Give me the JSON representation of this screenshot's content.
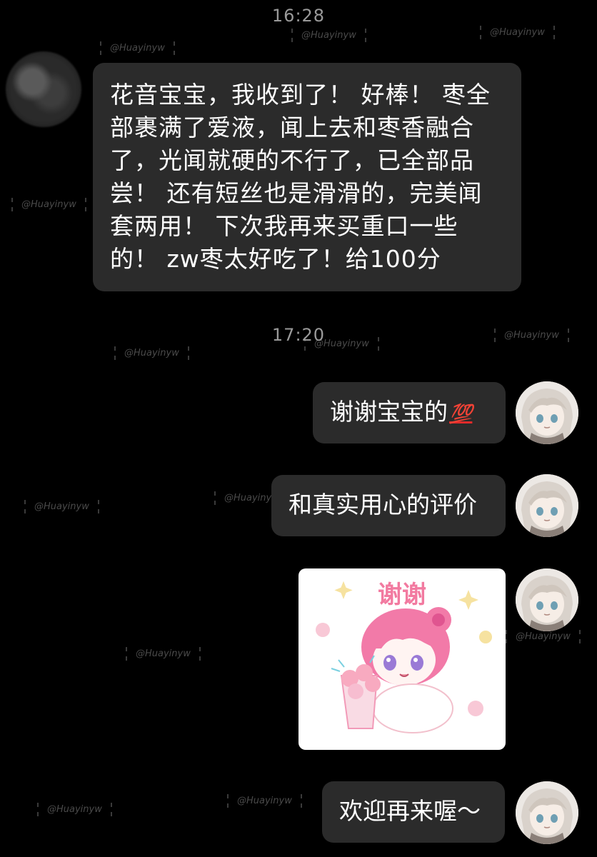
{
  "chat": {
    "time_1": "16:28",
    "time_2": "17:20",
    "incoming_message": "花音宝宝，我收到了！ 好棒！ 枣全部裹满了爱液，闻上去和枣香融合了，光闻就硬的不行了，已全部品尝！ 还有短丝也是滑滑的，完美闻套两用！ 下次我再来买重口一些的！ zw枣太好吃了！给100分",
    "reply_1_text": "谢谢宝宝的",
    "reply_1_emoji": "💯",
    "reply_2": "和真实用心的评价",
    "sticker_text": "谢谢",
    "reply_4": "欢迎再来喔～"
  },
  "watermark": "@Huayinyw",
  "colors": {
    "background": "#000000",
    "bubble": "#2b2b2b",
    "text": "#ffffff",
    "timestamp": "#9a9a9a",
    "sticker_pink": "#f29ab8"
  }
}
